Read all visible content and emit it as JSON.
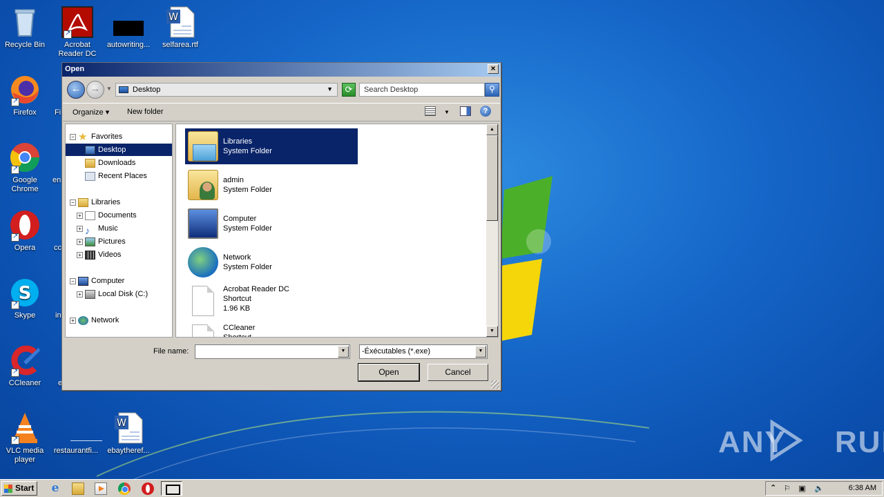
{
  "desktop": {
    "icons": [
      {
        "label": "Recycle Bin"
      },
      {
        "label": "Acrobat Reader DC"
      },
      {
        "label": "autowriting..."
      },
      {
        "label": "selfarea.rtf"
      },
      {
        "label": "Firefox"
      },
      {
        "label": "Fi"
      },
      {
        "label": "Google Chrome"
      },
      {
        "label": "en"
      },
      {
        "label": "Opera"
      },
      {
        "label": "cc"
      },
      {
        "label": "Skype"
      },
      {
        "label": "in"
      },
      {
        "label": "CCleaner"
      },
      {
        "label": "e"
      },
      {
        "label": "VLC media player"
      },
      {
        "label": "restaurantfi..."
      },
      {
        "label": "ebaytheref..."
      }
    ],
    "watermark_left": "ANY",
    "watermark_right": "RUN"
  },
  "dialog": {
    "title": "Open",
    "close_glyph": "×",
    "address": "Desktop",
    "search_placeholder": "Search Desktop",
    "toolbar": {
      "organize": "Organize ▾",
      "new_folder": "New folder",
      "help": "?"
    },
    "nav_tree": {
      "favorites": "Favorites",
      "desktop": "Desktop",
      "downloads": "Downloads",
      "recent_places": "Recent Places",
      "libraries": "Libraries",
      "documents": "Documents",
      "music": "Music",
      "pictures": "Pictures",
      "videos": "Videos",
      "computer": "Computer",
      "local_disk": "Local Disk (C:)",
      "network": "Network"
    },
    "files": [
      {
        "name": "Libraries",
        "type": "System Folder"
      },
      {
        "name": "admin",
        "type": "System Folder"
      },
      {
        "name": "Computer",
        "type": "System Folder"
      },
      {
        "name": "Network",
        "type": "System Folder"
      },
      {
        "name": "Acrobat Reader DC",
        "type": "Shortcut",
        "size": "1.96 KB"
      },
      {
        "name": "CCleaner",
        "type": "Shortcut"
      }
    ],
    "file_name_label": "File name:",
    "file_name_value": "",
    "file_type": "-Éxécutables  (*.exe)",
    "open_label": "Open",
    "cancel_label": "Cancel"
  },
  "taskbar": {
    "start_label": "Start",
    "clock": "6:38 AM"
  }
}
